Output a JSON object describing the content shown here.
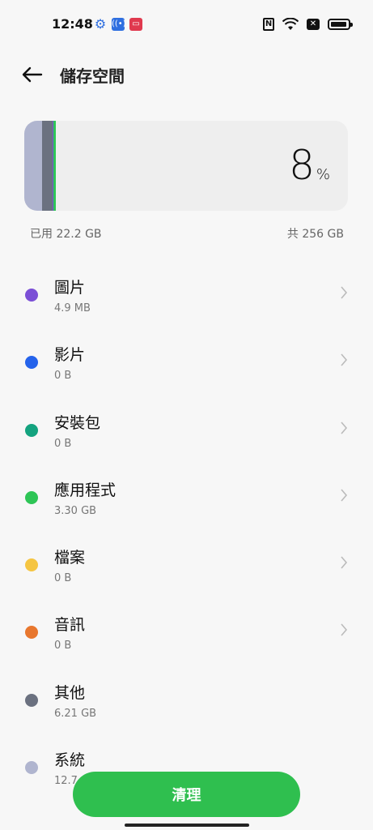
{
  "status_bar": {
    "time": "12:48",
    "icons": [
      "gear-icon",
      "cast-icon",
      "screen-record-icon",
      "nfc-icon",
      "wifi-icon",
      "xbox-icon",
      "battery-icon"
    ]
  },
  "header": {
    "title": "儲存空間",
    "back_icon": "arrow-left-icon"
  },
  "storage": {
    "percent": "8",
    "percent_sign": "%",
    "used_label": "已用 22.2 GB",
    "total_label": "共 256 GB",
    "used_fraction": 0.08
  },
  "categories": [
    {
      "name": "圖片",
      "size": "4.9 MB",
      "color": "#7b4fd6",
      "chevron": true
    },
    {
      "name": "影片",
      "size": "0 B",
      "color": "#2563eb",
      "chevron": true
    },
    {
      "name": "安裝包",
      "size": "0 B",
      "color": "#14a37f",
      "chevron": true
    },
    {
      "name": "應用程式",
      "size": "3.30  GB",
      "color": "#2ec556",
      "chevron": true
    },
    {
      "name": "檔案",
      "size": "0 B",
      "color": "#f5c542",
      "chevron": true
    },
    {
      "name": "音訊",
      "size": "0 B",
      "color": "#e8772e",
      "chevron": true
    },
    {
      "name": "其他",
      "size": "6.21 GB",
      "color": "#6b7180",
      "chevron": false
    },
    {
      "name": "系統",
      "size": "12.7",
      "color": "#b0b5cf",
      "chevron": false
    }
  ],
  "clean_button": {
    "label": "清理",
    "color": "#2fbf4f"
  }
}
